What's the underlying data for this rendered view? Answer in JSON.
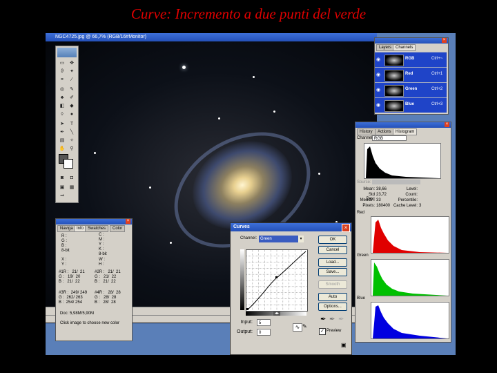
{
  "slide": {
    "title": "Curve: Incremento a due punti del verde"
  },
  "image_window": {
    "title": "NGC4725.jpg @ 66,7% (RGB/16#Monitor)"
  },
  "layers_palette": {
    "tabs": [
      "Layers",
      "Channels"
    ],
    "channels": [
      {
        "name": "RGB",
        "key": "Ctrl+~"
      },
      {
        "name": "Red",
        "key": "Ctrl+1"
      },
      {
        "name": "Green",
        "key": "Ctrl+2"
      },
      {
        "name": "Blue",
        "key": "Ctrl+3"
      }
    ]
  },
  "histogram_palette": {
    "tabs": [
      "History",
      "Actions",
      "Histogram"
    ],
    "channel_label": "Channel:",
    "channel_value": "RGB",
    "source_label": "Source:",
    "stats": {
      "mean_label": "Mean:",
      "mean": "38,66",
      "stddev_label": "Std Dev:",
      "stddev": "23,72",
      "median_label": "Median:",
      "median": "33",
      "pixels_label": "Pixels:",
      "pixels": "180400",
      "level_label": "Level:",
      "count_label": "Count:",
      "percentile_label": "Percentile:",
      "cache_label": "Cache Level:",
      "cache": "3"
    },
    "channels": [
      "Red",
      "Green",
      "Blue"
    ]
  },
  "info_palette": {
    "tabs": [
      "Naviga",
      "Info",
      "Swatches",
      "Color"
    ],
    "block1": "R :\nG :\nB :\n8-bit",
    "block1b": "C :\nM :\nY :\nK :\n8-bit",
    "block2": "X :\nY :",
    "block2b": "W :\nH :",
    "block3": "#1R :   21/  21\nG :   19/  20\nB :   21/  22",
    "block3b": "#2R :   21/  21\nG :   21/  22\nB :   21/  22",
    "block4": "#3R :  249/ 249\nG :  262/ 263\nB :  254/ 254",
    "block4b": "#4R :   28/  28\nG :   28/  28\nB :   28/  28",
    "doc": "Doc: 5,98M/5,90M",
    "hint": "Click image to choose new color"
  },
  "curves": {
    "title": "Curves",
    "channel_label": "Channel:",
    "channel_value": "Green",
    "ok": "OK",
    "cancel": "Cancel",
    "load": "Load...",
    "save": "Save...",
    "smooth": "Smooth",
    "auto": "Auto",
    "options": "Options...",
    "input_label": "Input:",
    "input_value": "5",
    "output_label": "Output:",
    "output_value": "0",
    "preview": "Preview"
  },
  "colors": {
    "title_red": "#e00000",
    "selection_blue": "#1f44c8",
    "red": "#e00000",
    "green": "#00c000",
    "blue": "#0000e0"
  }
}
